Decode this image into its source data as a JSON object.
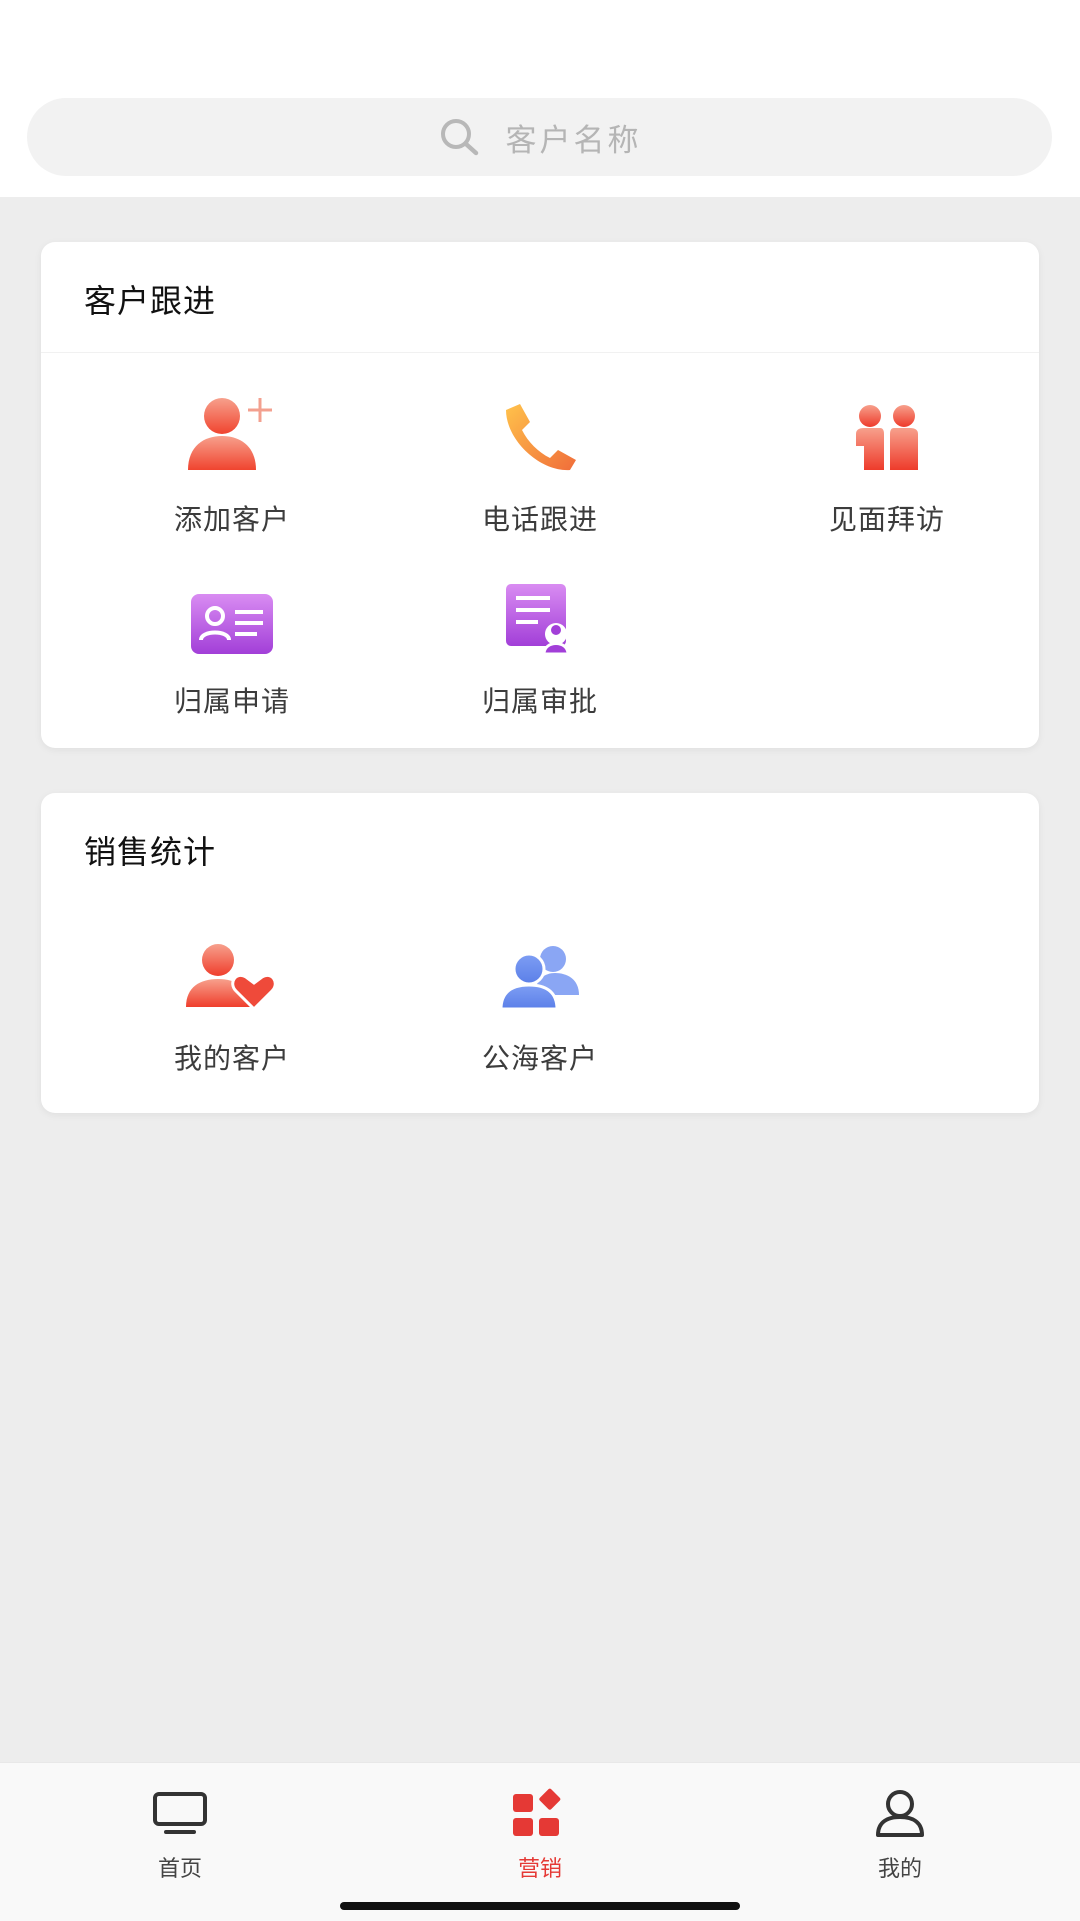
{
  "search": {
    "placeholder": "客户名称",
    "icon": "search-icon"
  },
  "follow_card": {
    "title": "客户跟进",
    "items": [
      {
        "label": "添加客户",
        "icon": "add-user-icon"
      },
      {
        "label": "电话跟进",
        "icon": "phone-icon"
      },
      {
        "label": "见面拜访",
        "icon": "meeting-icon"
      },
      {
        "label": "归属申请",
        "icon": "id-card-icon"
      },
      {
        "label": "归属审批",
        "icon": "approval-document-icon"
      }
    ]
  },
  "stats_card": {
    "title": "销售统计",
    "items": [
      {
        "label": "我的客户",
        "icon": "favorite-customer-icon"
      },
      {
        "label": "公海客户",
        "icon": "group-users-icon"
      }
    ]
  },
  "tabbar": {
    "active_color": "#e53935",
    "tabs": [
      {
        "label": "首页",
        "icon": "monitor-icon",
        "active": false
      },
      {
        "label": "营销",
        "icon": "apps-grid-icon",
        "active": true
      },
      {
        "label": "我的",
        "icon": "user-icon",
        "active": false
      }
    ]
  }
}
